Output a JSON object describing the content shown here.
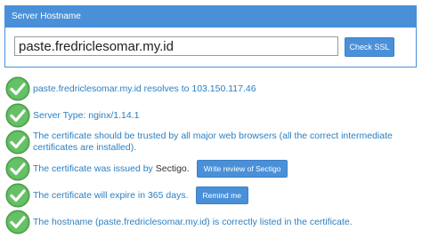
{
  "panel": {
    "title": "Server Hostname",
    "hostname_value": "paste.fredriclesomar.my.id",
    "check_button": "Check SSL"
  },
  "results": [
    {
      "text": "paste.fredriclesomar.my.id resolves to 103.150.117.46"
    },
    {
      "text": "Server Type: nginx/1.14.1"
    },
    {
      "line1": "The certificate should be trusted by all major web browsers (all the correct intermediate",
      "line2": "certificates are installed)."
    },
    {
      "text_before": "The certificate was issued by ",
      "issuer": "Sectigo",
      "text_after": ".",
      "button": "Write review of Sectigo"
    },
    {
      "text": "The certificate will expire in 365 days.",
      "button": "Remind me"
    },
    {
      "text": "The hostname (paste.fredriclesomar.my.id) is correctly listed in the certificate."
    }
  ],
  "colors": {
    "accent": "#4a90d9",
    "result_text": "#2b7fc1",
    "check_green": "#5cb85c"
  },
  "icons": {
    "check": "check-circle-icon"
  }
}
